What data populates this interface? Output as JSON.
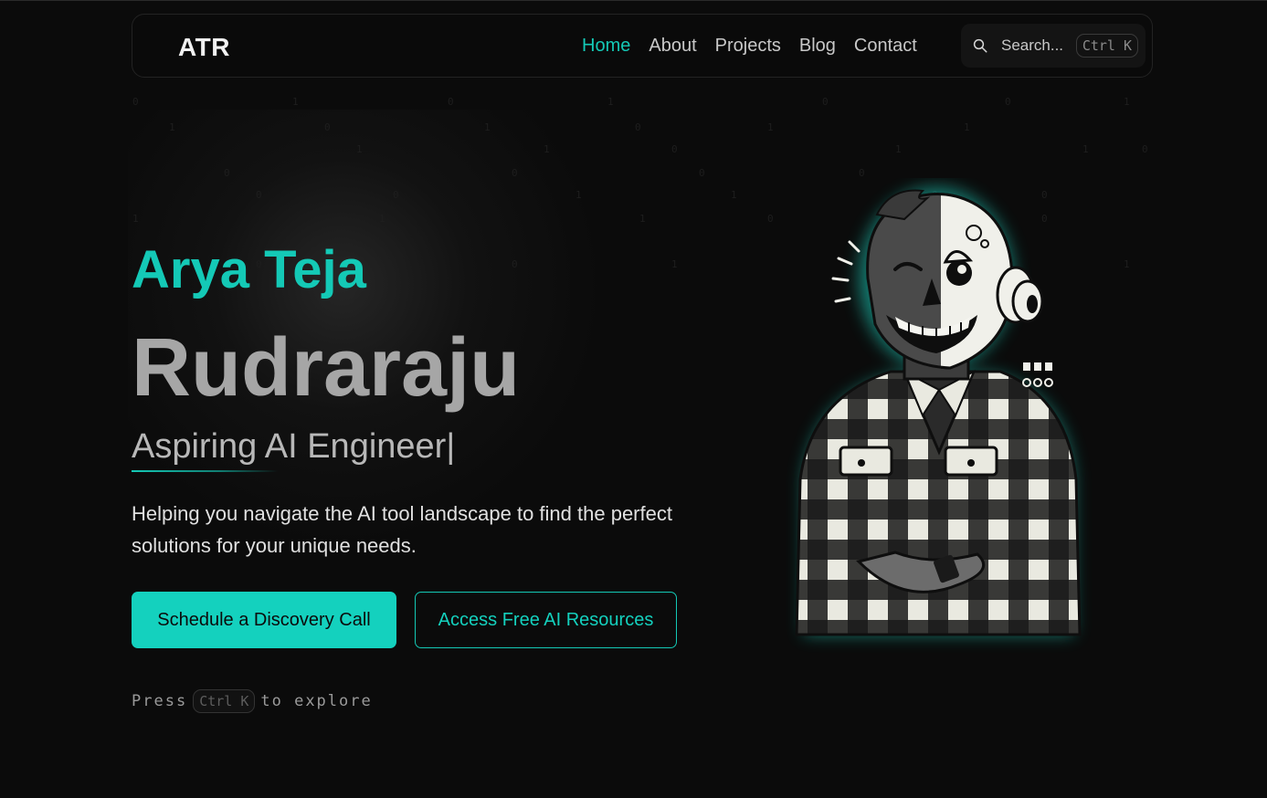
{
  "nav": {
    "logo": "ATR",
    "links": [
      {
        "label": "Home",
        "active": true
      },
      {
        "label": "About",
        "active": false
      },
      {
        "label": "Projects",
        "active": false
      },
      {
        "label": "Blog",
        "active": false
      },
      {
        "label": "Contact",
        "active": false
      }
    ],
    "search": {
      "placeholder": "Search...",
      "shortcut": "Ctrl K"
    }
  },
  "hero": {
    "first_name": "Arya Teja",
    "last_name": "Rudraraju",
    "role": "Aspiring AI Engineer",
    "cursor": "|",
    "tagline": "Helping you navigate the AI tool landscape to find the perfect solutions for your unique needs.",
    "primary_cta": "Schedule a Discovery Call",
    "secondary_cta": "Access Free AI Resources",
    "hint": {
      "before": "Press",
      "key": "Ctrl K",
      "after": "to explore"
    }
  },
  "illustration": {
    "icon": "skull-face-plaid-shirt-avatar"
  },
  "colors": {
    "accent": "#14c9b6",
    "background": "#0b0b0b"
  }
}
